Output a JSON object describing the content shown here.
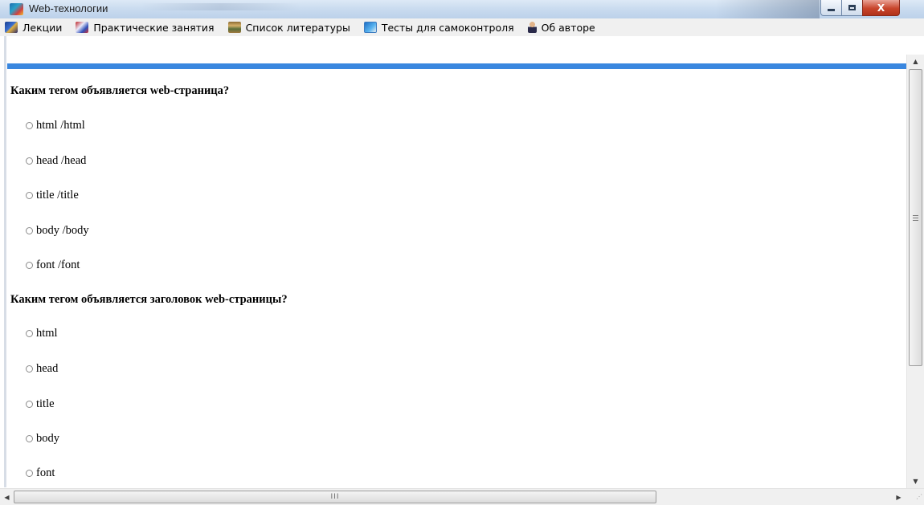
{
  "window": {
    "title": "Web-технологии",
    "buttons": {
      "minimize": "minimize",
      "maximize": "maximize",
      "close": "X"
    }
  },
  "menu": {
    "items": [
      {
        "label": "Лекции",
        "icon": "lectures-icon"
      },
      {
        "label": "Практические занятия",
        "icon": "practice-icon"
      },
      {
        "label": "Список литературы",
        "icon": "books-icon"
      },
      {
        "label": "Тесты для самоконтроля",
        "icon": "tests-icon"
      },
      {
        "label": "Об авторе",
        "icon": "author-icon"
      }
    ]
  },
  "colors": {
    "accent_bar": "#3a87df",
    "titlebar": "#c9dbef",
    "close_button": "#c8452b"
  },
  "quiz": {
    "questions": [
      {
        "text": "Каким тегом объявляется web-страница?",
        "options": [
          "html /html",
          "head /head",
          "title /title",
          "body /body",
          "font /font"
        ]
      },
      {
        "text": "Каким тегом объявляется заголовок web-страницы?",
        "options": [
          "html",
          "head",
          "title",
          "body",
          "font"
        ]
      }
    ]
  },
  "scrollbars": {
    "horizontal_grip": "III"
  }
}
